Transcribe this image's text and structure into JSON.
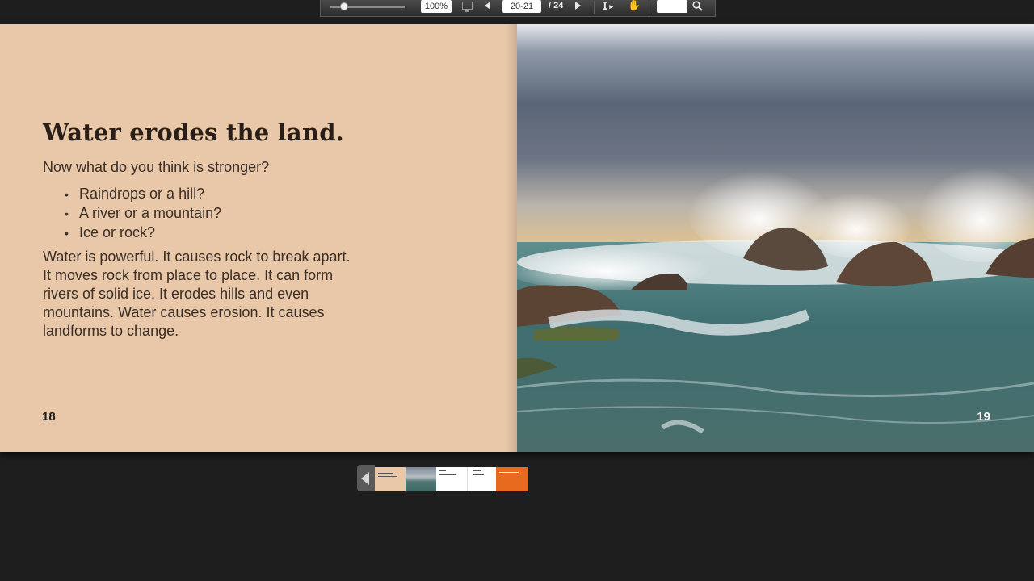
{
  "toolbar": {
    "zoom_value": "100%",
    "zoom_slider_fraction": 0.12,
    "page_value": "20-21",
    "page_total": "/ 24",
    "search_value": ""
  },
  "spread": {
    "left_page": {
      "title": "Water erodes the land.",
      "question": "Now what do you think is stronger?",
      "bullets": [
        "Raindrops or a hill?",
        "A river or a mountain?",
        "Ice or rock?"
      ],
      "paragraph_lines": [
        "Water is powerful. It causes rock to break apart.",
        "It moves rock from place to place. It can form",
        "rivers of solid ice. It erodes hills and even",
        "mountains. Water causes erosion. It causes",
        "landforms to change."
      ],
      "page_number": "18"
    },
    "right_page": {
      "image": "stormy-sea-waves-crashing-on-rocks",
      "page_number": "19"
    }
  },
  "thumbnails": {
    "items": [
      "pages-18-19",
      "pages-20-21",
      "pages-22-23"
    ]
  },
  "colors": {
    "left_page_bg": "#e8c8a8",
    "app_bg": "#1e1e1e",
    "thumb_orange": "#e86a1e"
  }
}
